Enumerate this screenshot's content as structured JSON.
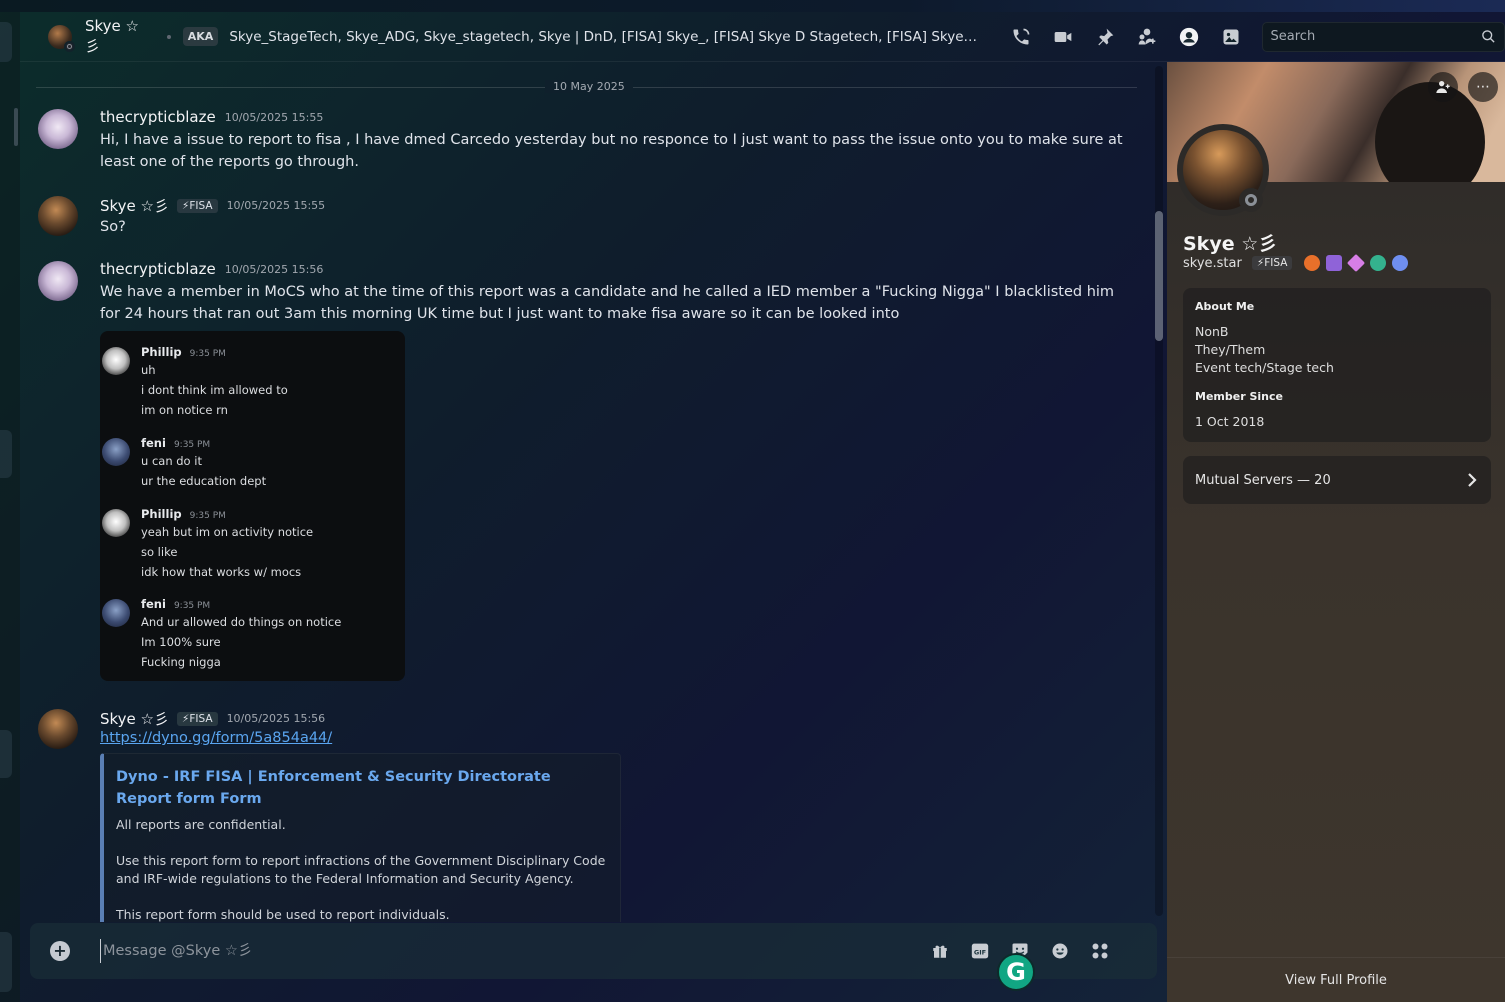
{
  "header": {
    "name": "Skye ☆彡",
    "aka_label": "AKA",
    "aka_list": "Skye_StageTech, Skye_ADG, Skye_stagetech, Skye | DnD, [FISA] Skye_, [FISA] Skye D Stagetech, [FISA] Skye_StageTech, S...",
    "search_placeholder": "Search",
    "icons": [
      "phone-call-icon",
      "video-camera-icon",
      "pin-icon",
      "add-friends-to-dm-icon",
      "user-profile-icon",
      "media-gallery-icon"
    ]
  },
  "chat": {
    "date_divider": "10 May 2025",
    "messages": [
      {
        "author": "thecrypticblaze",
        "timestamp": "10/05/2025 15:55",
        "text": "Hi, I have a issue to report to fisa , I have dmed Carcedo yesterday but no responce to I just want to pass the issue onto you to make sure at least one of the reports go through."
      },
      {
        "author": "Skye ☆彡",
        "badge": "⚡FISA",
        "timestamp": "10/05/2025 15:55",
        "text": "So?"
      },
      {
        "author": "thecrypticblaze",
        "timestamp": "10/05/2025 15:56",
        "text": "We have a member in MoCS who at the time of this report was a candidate and he called a IED member a \"Fucking Nigga\" I blacklisted him for 24 hours that ran out 3am this morning UK time but I just want to make fisa aware so it can be looked into"
      },
      {
        "author": "Skye ☆彡",
        "badge": "⚡FISA",
        "timestamp": "10/05/2025 15:56",
        "link": "https://dyno.gg/form/5a854a44/"
      }
    ],
    "screenshot": [
      {
        "name": "Phillip",
        "time": "9:35 PM",
        "lines": [
          "uh",
          "i dont think im allowed to",
          "im on notice rn"
        ]
      },
      {
        "name": "feni",
        "time": "9:35 PM",
        "lines": [
          "u can do it",
          "ur the education dept"
        ]
      },
      {
        "name": "Phillip",
        "time": "9:35 PM",
        "lines": [
          "yeah but im on activity notice",
          "so like",
          "idk how that works w/ mocs"
        ]
      },
      {
        "name": "feni",
        "time": "9:35 PM",
        "lines": [
          "And ur allowed do things on notice",
          "Im 100% sure",
          "Fucking nigga"
        ]
      }
    ],
    "embed": {
      "title": "Dyno - IRF FISA | Enforcement & Security Directorate Report form Form",
      "p1": "All reports are confidential.",
      "p2": "Use this report form to report infractions of the Government Disciplinary Code and IRF-wide regulations to the Federal Information and Security Agency.",
      "p3": "This report form should be used to report individuals."
    }
  },
  "composer": {
    "placeholder": "Message @Skye ☆彡",
    "icons": [
      "gift-icon",
      "gif-icon",
      "sticker-icon",
      "emoji-icon",
      "apps-icon"
    ]
  },
  "profile": {
    "name": "Skye ☆彡",
    "handle": "skye.star",
    "tag": "⚡FISA",
    "about_label": "About Me",
    "about_lines": [
      "NonB",
      "They/Them",
      "Event tech/Stage tech"
    ],
    "member_since_label": "Member Since",
    "member_since": "1 Oct 2018",
    "mutual_servers": "Mutual Servers — 20",
    "view_full": "View Full Profile",
    "badge_colors": [
      "#e8702a",
      "#8f63d8",
      "#d77ee6",
      "#34b28e",
      "#6f8ff0"
    ]
  },
  "colors": {
    "link": "#5aa5f0",
    "embed_title": "#6aa8ee",
    "embed_border": "#5a7fb4",
    "grammarly": "#11a683"
  }
}
